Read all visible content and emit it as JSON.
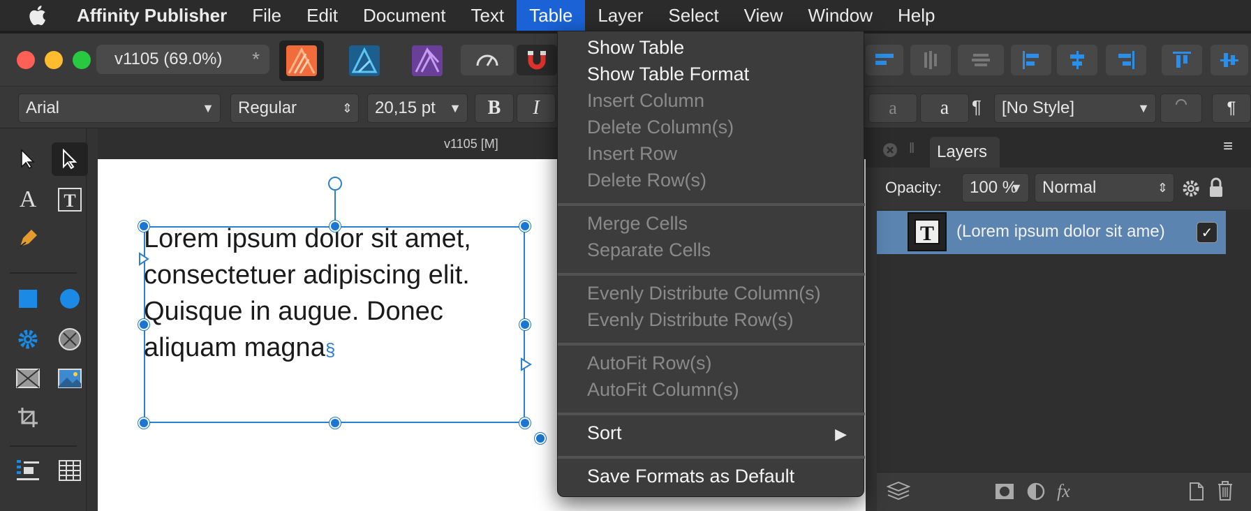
{
  "menubar": {
    "app": "Affinity Publisher",
    "items": [
      "File",
      "Edit",
      "Document",
      "Text",
      "Table",
      "Layer",
      "Select",
      "View",
      "Window",
      "Help"
    ],
    "active": "Table"
  },
  "toolbar": {
    "document_title": "v1105  (69.0%)",
    "modified_marker": "*",
    "colors": {
      "close": "#fe5f57",
      "minimize": "#febc2e",
      "zoom": "#28c840",
      "accent": "#1a62d6",
      "selection": "#5b84b1"
    }
  },
  "contextbar": {
    "font_family": "Arial",
    "font_style": "Regular",
    "font_size": "20,15 pt",
    "bold": "B",
    "italic": "I",
    "char_a1": "a",
    "char_a2": "a",
    "para_mark": "¶",
    "para_style": "[No Style]",
    "para_mark2": "¶"
  },
  "document": {
    "tab_title": "v1105  [M]",
    "body_text": "Lorem ipsum dolor sit amet,\nconsectetuer adipiscing elit.\nQuisque in augue. Donec\naliquam magna",
    "end_mark": "§"
  },
  "table_menu": {
    "groups": [
      [
        {
          "label": "Show Table",
          "enabled": true
        },
        {
          "label": "Show Table Format",
          "enabled": true
        },
        {
          "label": "Insert Column",
          "enabled": false
        },
        {
          "label": "Delete Column(s)",
          "enabled": false
        },
        {
          "label": "Insert Row",
          "enabled": false
        },
        {
          "label": "Delete Row(s)",
          "enabled": false
        }
      ],
      [
        {
          "label": "Merge Cells",
          "enabled": false
        },
        {
          "label": "Separate Cells",
          "enabled": false
        }
      ],
      [
        {
          "label": "Evenly Distribute Column(s)",
          "enabled": false
        },
        {
          "label": "Evenly Distribute Row(s)",
          "enabled": false
        }
      ],
      [
        {
          "label": "AutoFit Row(s)",
          "enabled": false
        },
        {
          "label": "AutoFit Column(s)",
          "enabled": false
        }
      ],
      [
        {
          "label": "Sort",
          "enabled": true,
          "submenu": true
        }
      ],
      [
        {
          "label": "Save Formats as Default",
          "enabled": true
        }
      ]
    ]
  },
  "layers_panel": {
    "tab_label": "Layers",
    "opacity_label": "Opacity:",
    "opacity_value": "100 %",
    "blend_mode": "Normal",
    "layer_name": "(Lorem ipsum dolor sit ame)",
    "layer_visible": "✓",
    "thumb_glyph": "T"
  }
}
